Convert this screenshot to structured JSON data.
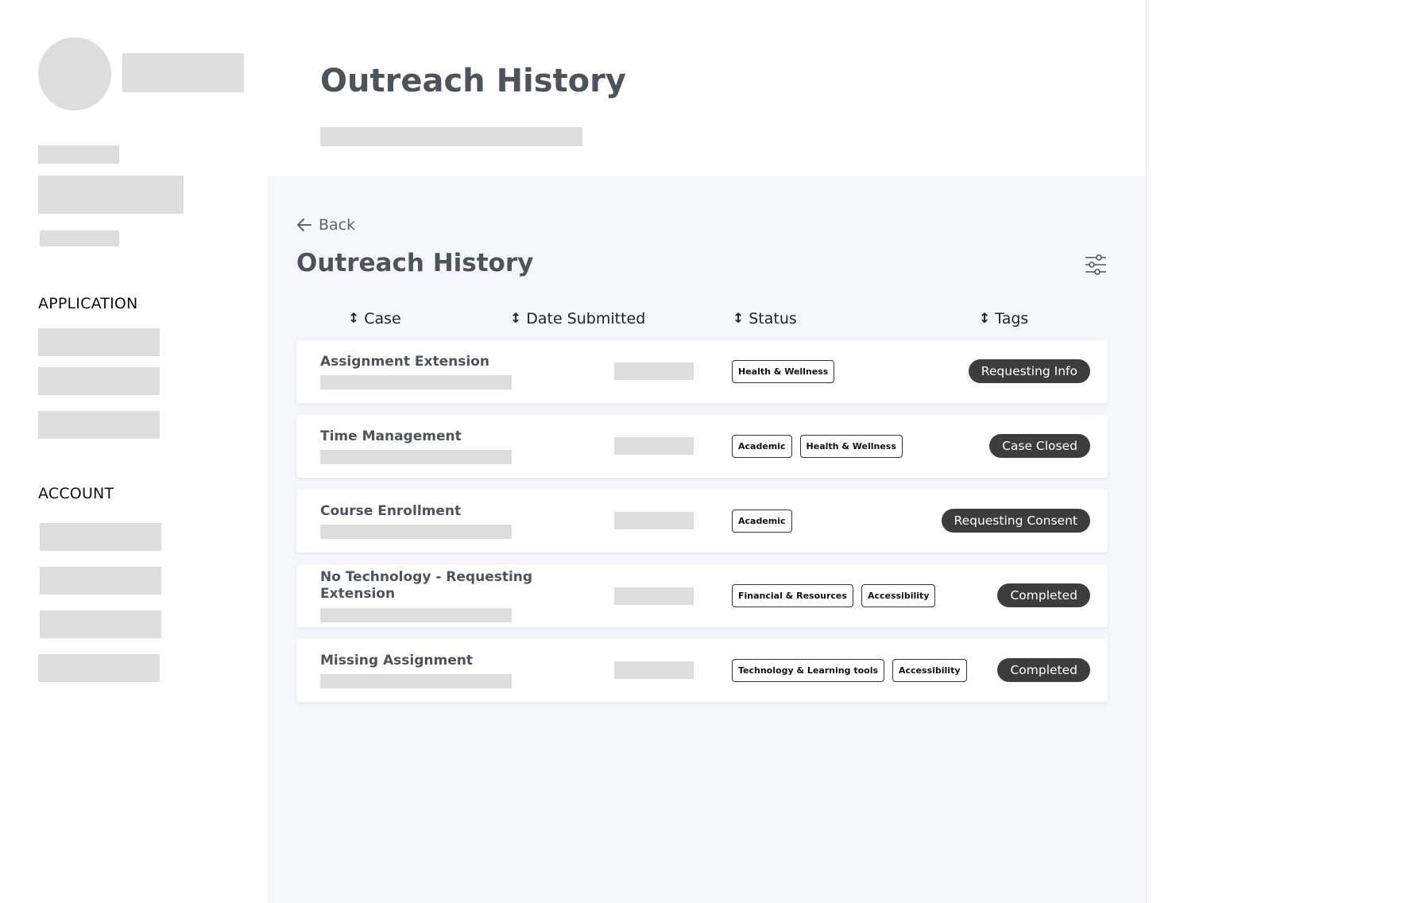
{
  "page": {
    "title": "Outreach History"
  },
  "sidebar": {
    "section_application": "APPLICATION",
    "section_account": "ACCOUNT"
  },
  "panel": {
    "back_label": "Back",
    "title": "Outreach History",
    "filter_icon": "sliders-icon"
  },
  "table": {
    "columns": [
      "Case",
      "Date Submitted",
      "Status",
      "Tags"
    ],
    "rows": [
      {
        "case": "Assignment Extension",
        "status": [
          "Health & Wellness"
        ],
        "tag": "Requesting Info"
      },
      {
        "case": "Time Management",
        "status": [
          "Academic",
          "Health & Wellness"
        ],
        "tag": "Case Closed"
      },
      {
        "case": "Course Enrollment",
        "status": [
          "Academic"
        ],
        "tag": "Requesting Consent"
      },
      {
        "case": "No Technology - Requesting Extension",
        "status": [
          "Financial & Resources",
          "Accessibility"
        ],
        "tag": "Completed"
      },
      {
        "case": "Missing Assignment",
        "status": [
          "Technology & Learning tools",
          "Accessibility"
        ],
        "tag": "Completed"
      }
    ]
  },
  "colors": {
    "panel_bg": "#f4f7fb",
    "tag_bg": "#3d3d3d",
    "skeleton": "#dddddd",
    "heading": "#4b535c"
  }
}
